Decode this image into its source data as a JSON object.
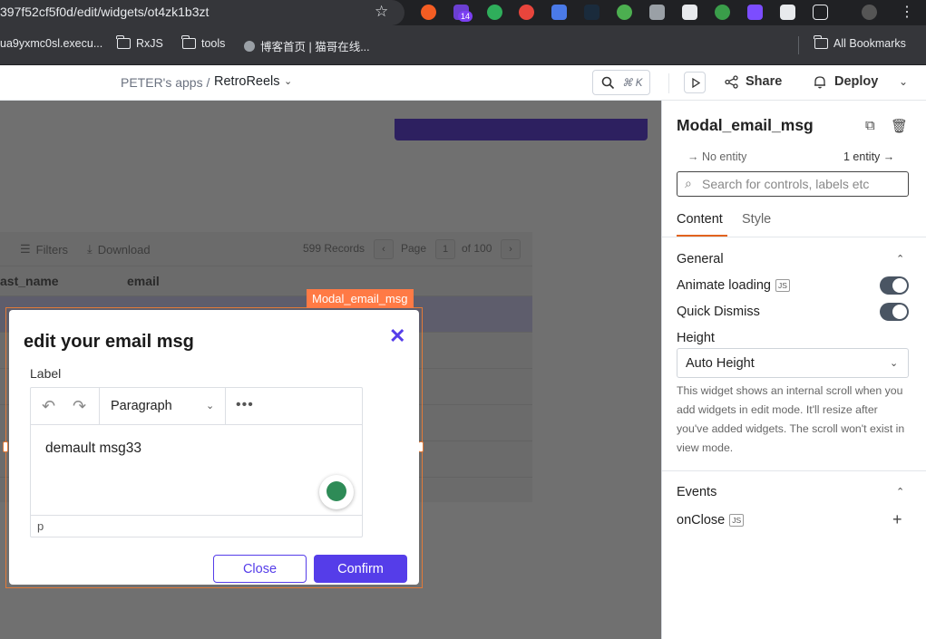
{
  "browser": {
    "url": "397f52cf5f0d/edit/widgets/ot4zk1b3zt",
    "extension_badge": "14",
    "bookmarks": [
      {
        "label": "ua9yxmc0sl.execu..."
      },
      {
        "label": "RxJS"
      },
      {
        "label": "tools"
      },
      {
        "label": "博客首页 | 猫哥在线..."
      },
      {
        "label": "All Bookmarks"
      }
    ]
  },
  "header": {
    "workspace": "PETER's apps /",
    "app_name": "RetroReels",
    "omnibar_shortcut": "⌘ K",
    "share_label": "Share",
    "deploy_label": "Deploy"
  },
  "canvas": {
    "table": {
      "filters_label": "Filters",
      "download_label": "Download",
      "records": "599 Records",
      "page_label": "Page",
      "page_number": "1",
      "page_total": "of 100",
      "columns": [
        "ast_name",
        "email"
      ]
    },
    "modal_tag": "Modal_email_msg",
    "modal": {
      "title": "edit your email msg",
      "close_icon": "✕",
      "field_label": "Label",
      "paragraph_select": "Paragraph",
      "more_icon": "•••",
      "body_text": "demault msg33",
      "status_text": "p",
      "close_button": "Close",
      "confirm_button": "Confirm"
    }
  },
  "pane": {
    "widget_name": "Modal_email_msg",
    "no_entity": "No entity",
    "one_entity": "1 entity",
    "search_placeholder": "Search for controls, labels etc",
    "tabs": {
      "content": "Content",
      "style": "Style"
    },
    "general": {
      "title": "General",
      "animate_loading": "Animate loading",
      "quick_dismiss": "Quick Dismiss",
      "height_label": "Height",
      "height_value": "Auto Height",
      "help_text": "This widget shows an internal scroll when you add widgets in edit mode. It'll resize after you've added widgets. The scroll won't exist in view mode."
    },
    "events": {
      "title": "Events",
      "on_close": "onClose"
    },
    "js_badge": "JS"
  },
  "colors": {
    "accent": "#553de9",
    "selection": "#ff7a45",
    "tab_underline": "#e2631e"
  }
}
